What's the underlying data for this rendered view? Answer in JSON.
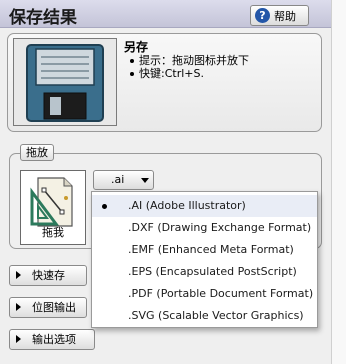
{
  "header": {
    "title": "保存结果",
    "help_label": "帮助"
  },
  "save_info": {
    "title": "另存",
    "bullets": [
      "提示：拖动图标并放下",
      "快键:Ctrl+S."
    ]
  },
  "drag_section": {
    "legend": "拖放",
    "drag_label": "拖我",
    "selected_format": ".ai"
  },
  "format_menu": {
    "items": [
      ".AI (Adobe Illustrator)",
      ".DXF (Drawing Exchange Format)",
      ".EMF (Enhanced Meta Format)",
      ".EPS (Encapsulated PostScript)",
      ".PDF (Portable Document Format)",
      ".SVG (Scalable Vector Graphics)"
    ]
  },
  "side_buttons": {
    "quick_save": "快速存",
    "bitmap_output": "位图输出",
    "output_options": "输出选项"
  },
  "colors": {
    "header_bg": "#c8c8dc",
    "help_icon": "#2356a8",
    "floppy_body": "#3a6e8c"
  }
}
